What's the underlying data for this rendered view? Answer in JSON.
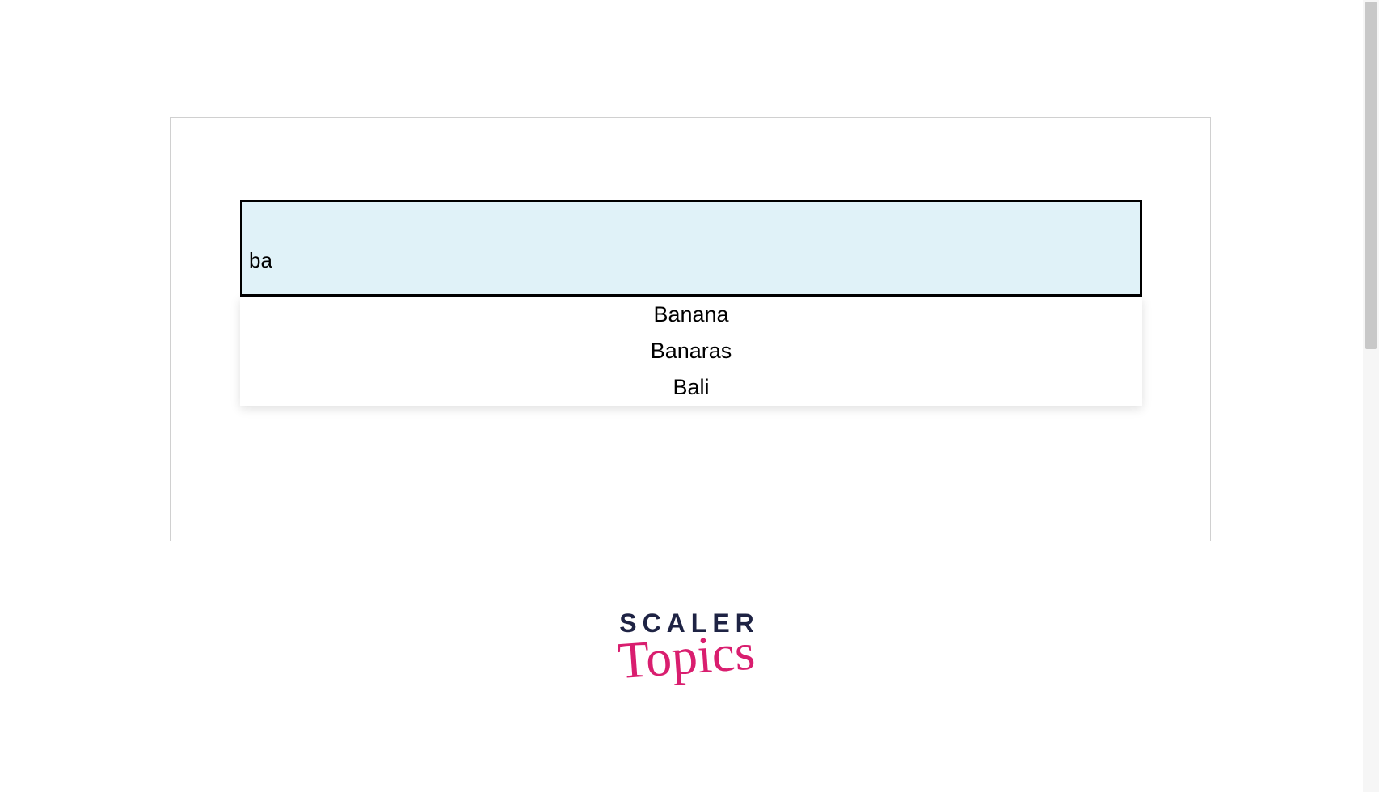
{
  "search": {
    "value": "ba"
  },
  "suggestions": [
    "Banana",
    "Banaras",
    "Bali"
  ],
  "logo": {
    "line1": "SCALER",
    "line2": "Topics"
  },
  "colors": {
    "input_bg": "#e0f2f8",
    "input_border": "#000000",
    "logo_dark": "#1e2344",
    "logo_pink": "#d91e6f"
  }
}
